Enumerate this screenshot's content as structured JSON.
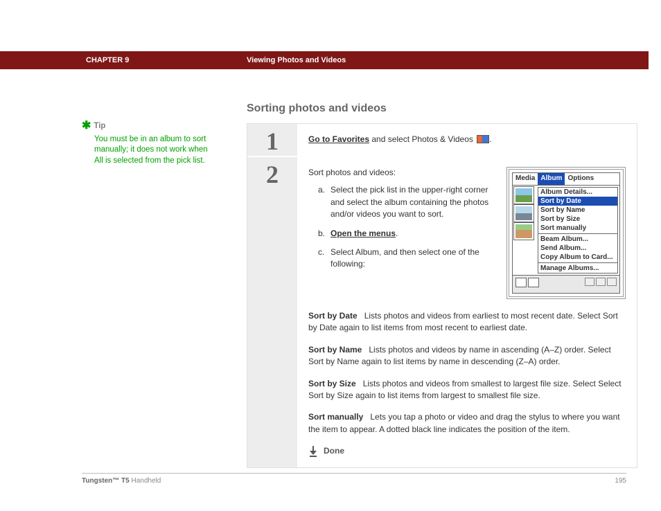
{
  "header": {
    "chapter": "CHAPTER 9",
    "title": "Viewing Photos and Videos"
  },
  "sidebar": {
    "tip_label": "Tip",
    "tip_body": "You must be in an album to sort manually; it does not work when All is selected from the pick list."
  },
  "main": {
    "heading": "Sorting photos and videos",
    "step1": {
      "num": "1",
      "link": "Go to Favorites",
      "rest": " and select Photos & Videos "
    },
    "step2": {
      "num": "2",
      "intro": "Sort photos and videos:",
      "a": "Select the pick list in the upper-right corner and select the album containing the photos and/or videos you want to sort.",
      "b_link": "Open the menus",
      "c": "Select Album, and then select one of the following:",
      "defs": {
        "sortdate_t": "Sort by Date",
        "sortdate_d": "Lists photos and videos from earliest to most recent date. Select Sort by Date again to list items from most recent to earliest date.",
        "sortname_t": "Sort by Name",
        "sortname_d": "Lists photos and videos by name in ascending (A–Z) order. Select Sort by Name again to list items by name in descending (Z–A) order.",
        "sortsize_t": "Sort by Size",
        "sortsize_d": "Lists photos and videos from smallest to largest file size. Select Select Sort by Size again to list items from largest to smallest file size.",
        "sortman_t": "Sort manually",
        "sortman_d": "Lets you tap a photo or video and drag the stylus to where you want the item to appear. A dotted black line indicates the position of the item."
      },
      "done": "Done"
    }
  },
  "device": {
    "tabs": {
      "media": "Media",
      "album": "Album",
      "options": "Options"
    },
    "menu": {
      "details": "Album Details...",
      "sortdate": "Sort by Date",
      "sortname": "Sort by Name",
      "sortsize": "Sort by Size",
      "sortman": "Sort manually",
      "beam": "Beam Album...",
      "send": "Send Album...",
      "copy": "Copy Album to Card...",
      "manage": "Manage Albums..."
    }
  },
  "footer": {
    "product_bold": "Tungsten™ T5",
    "product_rest": " Handheld",
    "page": "195"
  }
}
